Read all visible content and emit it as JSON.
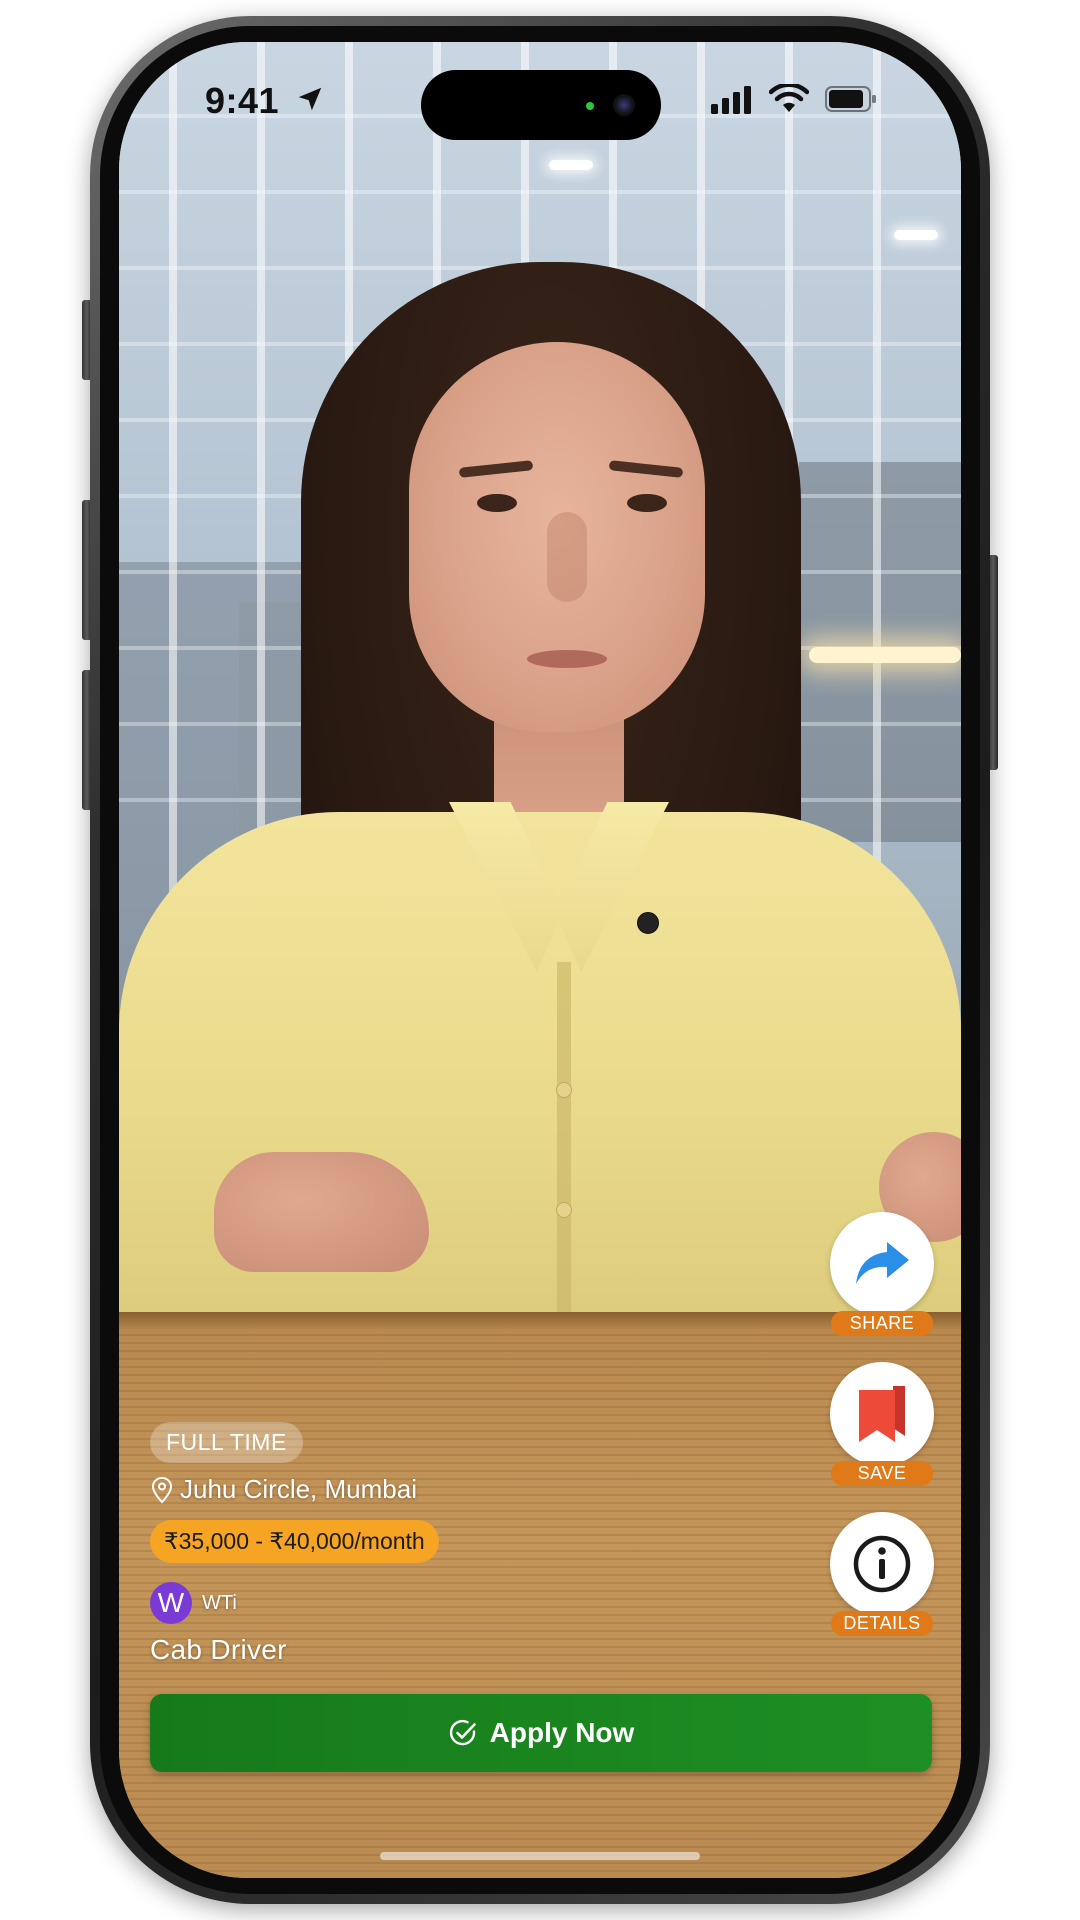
{
  "status_bar": {
    "time": "9:41",
    "icons": [
      "location-arrow-icon",
      "cellular-signal-icon",
      "wifi-icon",
      "battery-icon"
    ]
  },
  "actions": {
    "share": {
      "label": "SHARE",
      "icon": "share-arrow-icon"
    },
    "save": {
      "label": "SAVE",
      "icon": "bookmark-icon"
    },
    "details": {
      "label": "DETAILS",
      "icon": "info-icon"
    }
  },
  "job": {
    "type": "FULL TIME",
    "location": "Juhu Circle, Mumbai",
    "salary": "₹35,000 - ₹40,000/month",
    "company_initial": "W",
    "company_name": "WTi",
    "title": "Cab Driver"
  },
  "apply": {
    "label": "Apply Now",
    "icon": "check-circle-icon"
  },
  "colors": {
    "apply_green": "#1e8f24",
    "action_label_orange": "#e07a18",
    "salary_badge": "#f6a423",
    "company_logo_purple": "#7a3ad6",
    "share_icon_blue": "#2b8fe8",
    "save_icon_red": "#ee4a3a"
  }
}
